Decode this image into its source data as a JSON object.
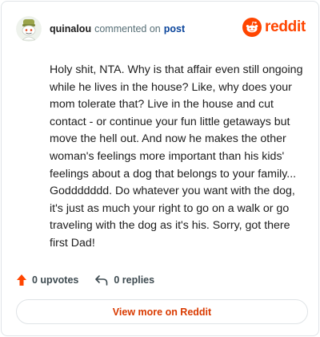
{
  "header": {
    "username": "quinalou",
    "action_text": "commented on",
    "post_link": "post",
    "brand_name": "reddit"
  },
  "comment": {
    "body": "Holy shit, NTA. Why is that affair even still ongoing while he lives in the house? Like, why does your mom tolerate that? Live in the house and cut contact - or continue your fun little getaways but move the hell out. And now he makes the other woman's feelings more important than his kids' feelings about a dog that belongs to your family... Goddddddd. Do whatever you want with the dog, it's just as much your right to go on a walk or go traveling with the dog as it's his. Sorry, got there first Dad!"
  },
  "actions": {
    "upvotes": "0 upvotes",
    "replies": "0 replies"
  },
  "footer": {
    "view_more": "View more on Reddit"
  },
  "colors": {
    "brand": "#ff4500",
    "upvote_arrow": "#ff4500",
    "link": "#0a449b",
    "view_more_text": "#d93a00"
  },
  "icons": {
    "avatar": "snoo-avatar-icon",
    "brand": "reddit-logo-icon",
    "upvote": "upvote-arrow-icon",
    "reply": "reply-arrow-icon"
  }
}
